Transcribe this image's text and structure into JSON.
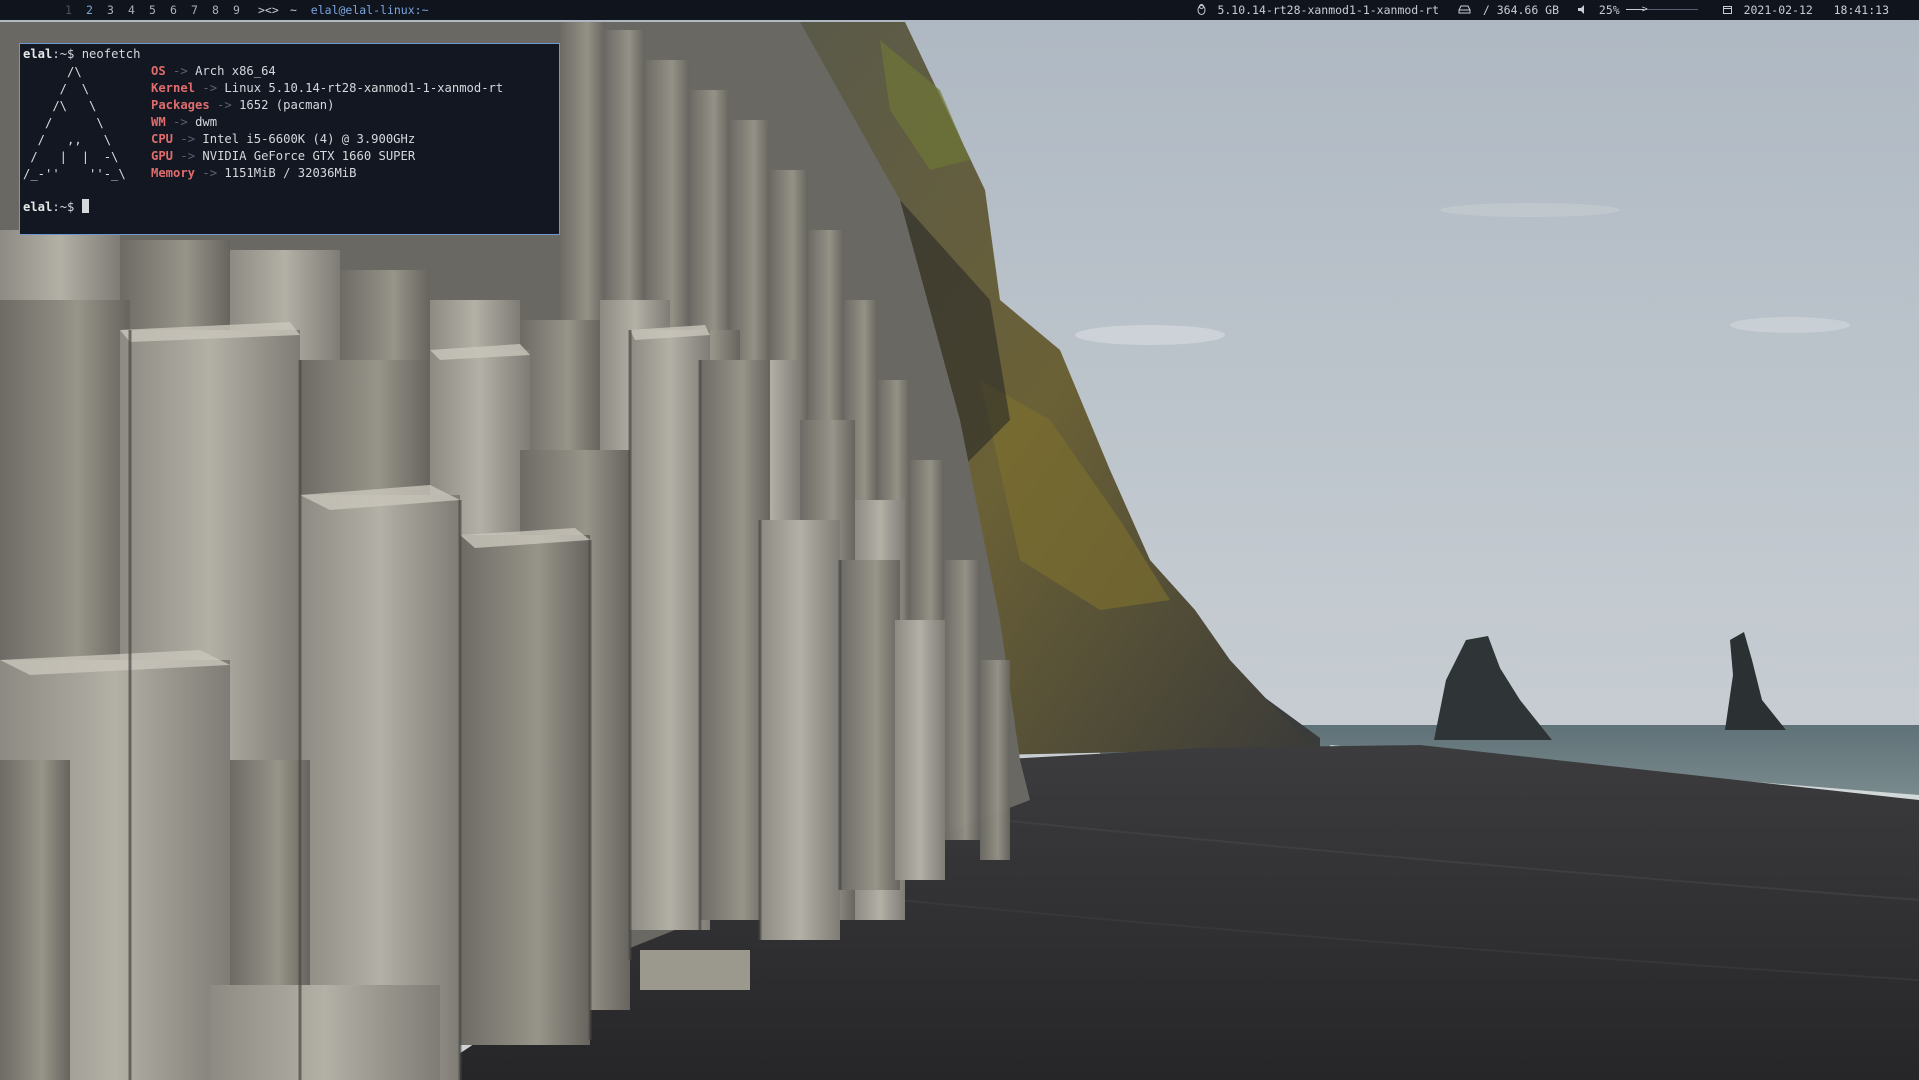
{
  "bar": {
    "tags": [
      "1",
      "2",
      "3",
      "4",
      "5",
      "6",
      "7",
      "8",
      "9"
    ],
    "selected_tag": "2",
    "layout_symbol": "><>",
    "window_title_prefix": "~",
    "window_title": "elal@elal-linux:~",
    "kernel_icon": "linux-penguin-icon",
    "kernel": "5.10.14-rt28-xanmod1-1-xanmod-rt",
    "disk_icon": "hard-drive-icon",
    "disk": "/ 364.66 GB",
    "volume_icon": "speaker-icon",
    "volume": "25%",
    "volume_level": 0.25,
    "calendar_icon": "calendar-icon",
    "date": "2021-02-12",
    "time": "18:41:13"
  },
  "terminal": {
    "prompt_user": "elal",
    "prompt_path": ":~$",
    "command": "neofetch",
    "ascii_art": "      /\\\n     /  \\\n    /\\   \\\n   /      \\\n  /   ,,   \\\n /   |  |  -\\\n/_-''    ''-_\\",
    "arrow": "->",
    "info": [
      {
        "key": "OS",
        "value": "Arch x86_64"
      },
      {
        "key": "Kernel",
        "value": "Linux 5.10.14-rt28-xanmod1-1-xanmod-rt"
      },
      {
        "key": "Packages",
        "value": "1652 (pacman)"
      },
      {
        "key": "WM",
        "value": "dwm"
      },
      {
        "key": "CPU",
        "value": "Intel i5-6600K (4) @ 3.900GHz"
      },
      {
        "key": "GPU",
        "value": "NVIDIA GeForce GTX 1660 SUPER"
      },
      {
        "key": "Memory",
        "value": "1151MiB / 32036MiB"
      }
    ]
  },
  "colors": {
    "bar_bg": "#10141c",
    "accent": "#7aa6e0",
    "neofetch_key": "#e06c6c",
    "terminal_bg": "#121722"
  }
}
